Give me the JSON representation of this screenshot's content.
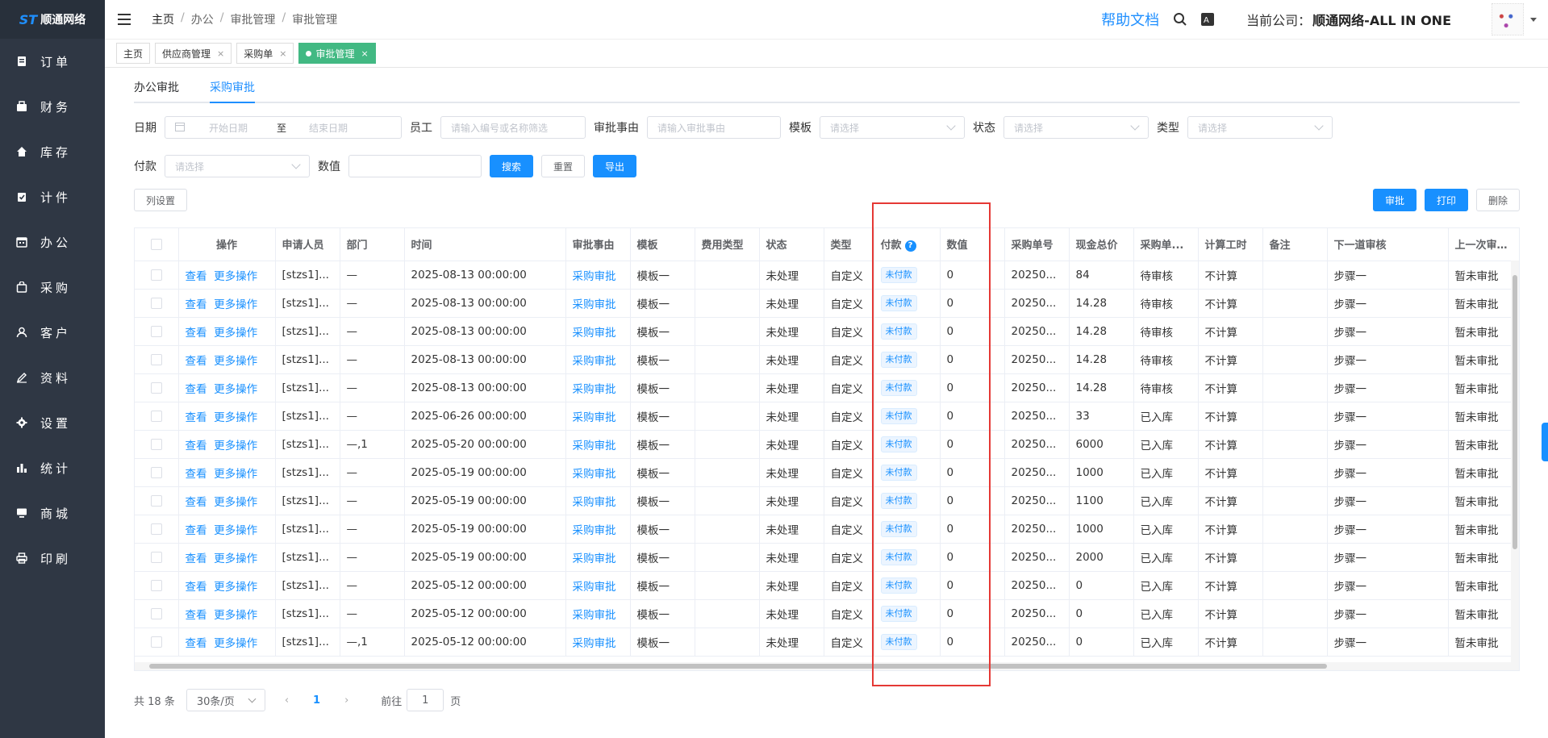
{
  "app": {
    "logo_mark": "ST",
    "logo_text": "顺通网络"
  },
  "sidebar": {
    "items": [
      {
        "label": "订单",
        "icon": "order-icon"
      },
      {
        "label": "财务",
        "icon": "finance-icon"
      },
      {
        "label": "库存",
        "icon": "home-icon"
      },
      {
        "label": "计件",
        "icon": "clipboard-icon"
      },
      {
        "label": "办公",
        "icon": "calendar-icon"
      },
      {
        "label": "采购",
        "icon": "bag-icon"
      },
      {
        "label": "客户",
        "icon": "user-icon"
      },
      {
        "label": "资料",
        "icon": "edit-icon"
      },
      {
        "label": "设置",
        "icon": "gear-icon"
      },
      {
        "label": "统计",
        "icon": "chart-icon"
      },
      {
        "label": "商城",
        "icon": "monitor-icon"
      },
      {
        "label": "印刷",
        "icon": "printer-icon"
      }
    ]
  },
  "header": {
    "breadcrumbs": [
      "主页",
      "办公",
      "审批管理",
      "审批管理"
    ],
    "help": "帮助文档",
    "company_label": "当前公司：",
    "company_name": "顺通网络-ALL IN ONE"
  },
  "page_tabs": [
    {
      "label": "主页",
      "closable": false,
      "active": false
    },
    {
      "label": "供应商管理",
      "closable": true,
      "active": false
    },
    {
      "label": "采购单",
      "closable": true,
      "active": false
    },
    {
      "label": "审批管理",
      "closable": true,
      "active": true
    }
  ],
  "subtabs": [
    {
      "label": "办公审批",
      "active": false
    },
    {
      "label": "采购审批",
      "active": true
    }
  ],
  "filters": {
    "date_label": "日期",
    "start_placeholder": "开始日期",
    "to_label": "至",
    "end_placeholder": "结束日期",
    "employee_label": "员工",
    "employee_placeholder": "请输入编号或名称筛选",
    "reason_label": "审批事由",
    "reason_placeholder": "请输入审批事由",
    "template_label": "模板",
    "template_placeholder": "请选择",
    "status_label": "状态",
    "status_placeholder": "请选择",
    "type_label": "类型",
    "type_placeholder": "请选择",
    "payment_label": "付款",
    "payment_placeholder": "请选择",
    "value_label": "数值",
    "value_value": "",
    "search_btn": "搜索",
    "reset_btn": "重置",
    "export_btn": "导出"
  },
  "toolbar": {
    "columns_btn": "列设置",
    "approve_btn": "审批",
    "print_btn": "打印",
    "delete_btn": "删除"
  },
  "table": {
    "headers": [
      "操作",
      "申请人员",
      "部门",
      "时间",
      "审批事由",
      "模板",
      "费用类型",
      "状态",
      "类型",
      "付款",
      "数值",
      "采购单号",
      "现金总价",
      "采购单...",
      "计算工时",
      "备注",
      "下一道审核",
      "上一次审批时"
    ],
    "view_label": "查看",
    "more_label": "更多操作",
    "rows": [
      {
        "applicant": "[stzs1]...",
        "dept": "—",
        "time": "2025-08-13 00:00:00",
        "reason": "采购审批",
        "template": "模板一",
        "fee": "",
        "status": "未处理",
        "type": "自定义",
        "pay": "未付款",
        "value": "0",
        "po": "20250...",
        "total": "84",
        "po_status": "待审核",
        "hours": "不计算",
        "remark": "",
        "next": "步骤一",
        "last": "暂未审批"
      },
      {
        "applicant": "[stzs1]...",
        "dept": "—",
        "time": "2025-08-13 00:00:00",
        "reason": "采购审批",
        "template": "模板一",
        "fee": "",
        "status": "未处理",
        "type": "自定义",
        "pay": "未付款",
        "value": "0",
        "po": "20250...",
        "total": "14.28",
        "po_status": "待审核",
        "hours": "不计算",
        "remark": "",
        "next": "步骤一",
        "last": "暂未审批"
      },
      {
        "applicant": "[stzs1]...",
        "dept": "—",
        "time": "2025-08-13 00:00:00",
        "reason": "采购审批",
        "template": "模板一",
        "fee": "",
        "status": "未处理",
        "type": "自定义",
        "pay": "未付款",
        "value": "0",
        "po": "20250...",
        "total": "14.28",
        "po_status": "待审核",
        "hours": "不计算",
        "remark": "",
        "next": "步骤一",
        "last": "暂未审批"
      },
      {
        "applicant": "[stzs1]...",
        "dept": "—",
        "time": "2025-08-13 00:00:00",
        "reason": "采购审批",
        "template": "模板一",
        "fee": "",
        "status": "未处理",
        "type": "自定义",
        "pay": "未付款",
        "value": "0",
        "po": "20250...",
        "total": "14.28",
        "po_status": "待审核",
        "hours": "不计算",
        "remark": "",
        "next": "步骤一",
        "last": "暂未审批"
      },
      {
        "applicant": "[stzs1]...",
        "dept": "—",
        "time": "2025-08-13 00:00:00",
        "reason": "采购审批",
        "template": "模板一",
        "fee": "",
        "status": "未处理",
        "type": "自定义",
        "pay": "未付款",
        "value": "0",
        "po": "20250...",
        "total": "14.28",
        "po_status": "待审核",
        "hours": "不计算",
        "remark": "",
        "next": "步骤一",
        "last": "暂未审批"
      },
      {
        "applicant": "[stzs1]...",
        "dept": "—",
        "time": "2025-06-26 00:00:00",
        "reason": "采购审批",
        "template": "模板一",
        "fee": "",
        "status": "未处理",
        "type": "自定义",
        "pay": "未付款",
        "value": "0",
        "po": "20250...",
        "total": "33",
        "po_status": "已入库",
        "hours": "不计算",
        "remark": "",
        "next": "步骤一",
        "last": "暂未审批"
      },
      {
        "applicant": "[stzs1]...",
        "dept": "—,1",
        "time": "2025-05-20 00:00:00",
        "reason": "采购审批",
        "template": "模板一",
        "fee": "",
        "status": "未处理",
        "type": "自定义",
        "pay": "未付款",
        "value": "0",
        "po": "20250...",
        "total": "6000",
        "po_status": "已入库",
        "hours": "不计算",
        "remark": "",
        "next": "步骤一",
        "last": "暂未审批"
      },
      {
        "applicant": "[stzs1]...",
        "dept": "—",
        "time": "2025-05-19 00:00:00",
        "reason": "采购审批",
        "template": "模板一",
        "fee": "",
        "status": "未处理",
        "type": "自定义",
        "pay": "未付款",
        "value": "0",
        "po": "20250...",
        "total": "1000",
        "po_status": "已入库",
        "hours": "不计算",
        "remark": "",
        "next": "步骤一",
        "last": "暂未审批"
      },
      {
        "applicant": "[stzs1]...",
        "dept": "—",
        "time": "2025-05-19 00:00:00",
        "reason": "采购审批",
        "template": "模板一",
        "fee": "",
        "status": "未处理",
        "type": "自定义",
        "pay": "未付款",
        "value": "0",
        "po": "20250...",
        "total": "1100",
        "po_status": "已入库",
        "hours": "不计算",
        "remark": "",
        "next": "步骤一",
        "last": "暂未审批"
      },
      {
        "applicant": "[stzs1]...",
        "dept": "—",
        "time": "2025-05-19 00:00:00",
        "reason": "采购审批",
        "template": "模板一",
        "fee": "",
        "status": "未处理",
        "type": "自定义",
        "pay": "未付款",
        "value": "0",
        "po": "20250...",
        "total": "1000",
        "po_status": "已入库",
        "hours": "不计算",
        "remark": "",
        "next": "步骤一",
        "last": "暂未审批"
      },
      {
        "applicant": "[stzs1]...",
        "dept": "—",
        "time": "2025-05-19 00:00:00",
        "reason": "采购审批",
        "template": "模板一",
        "fee": "",
        "status": "未处理",
        "type": "自定义",
        "pay": "未付款",
        "value": "0",
        "po": "20250...",
        "total": "2000",
        "po_status": "已入库",
        "hours": "不计算",
        "remark": "",
        "next": "步骤一",
        "last": "暂未审批"
      },
      {
        "applicant": "[stzs1]...",
        "dept": "—",
        "time": "2025-05-12 00:00:00",
        "reason": "采购审批",
        "template": "模板一",
        "fee": "",
        "status": "未处理",
        "type": "自定义",
        "pay": "未付款",
        "value": "0",
        "po": "20250...",
        "total": "0",
        "po_status": "已入库",
        "hours": "不计算",
        "remark": "",
        "next": "步骤一",
        "last": "暂未审批"
      },
      {
        "applicant": "[stzs1]...",
        "dept": "—",
        "time": "2025-05-12 00:00:00",
        "reason": "采购审批",
        "template": "模板一",
        "fee": "",
        "status": "未处理",
        "type": "自定义",
        "pay": "未付款",
        "value": "0",
        "po": "20250...",
        "total": "0",
        "po_status": "已入库",
        "hours": "不计算",
        "remark": "",
        "next": "步骤一",
        "last": "暂未审批"
      },
      {
        "applicant": "[stzs1]...",
        "dept": "—,1",
        "time": "2025-05-12 00:00:00",
        "reason": "采购审批",
        "template": "模板一",
        "fee": "",
        "status": "未处理",
        "type": "自定义",
        "pay": "未付款",
        "value": "0",
        "po": "20250...",
        "total": "0",
        "po_status": "已入库",
        "hours": "不计算",
        "remark": "",
        "next": "步骤一",
        "last": "暂未审批"
      }
    ]
  },
  "pagination": {
    "total_text": "共 18 条",
    "page_size": "30条/页",
    "current_page": "1",
    "goto_label": "前往",
    "goto_value": "1",
    "page_suffix": "页"
  },
  "colors": {
    "accent": "#1890ff",
    "sidebar_bg": "#2f3744",
    "active_tab": "#42b983",
    "highlight": "#e53935"
  }
}
